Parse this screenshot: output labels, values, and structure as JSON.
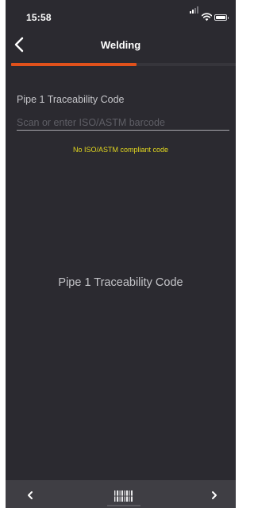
{
  "status_bar": {
    "time": "15:58"
  },
  "header": {
    "title": "Welding",
    "back_icon": "chevron-left-icon"
  },
  "progress": {
    "fraction": 0.56,
    "color": "#e0511b"
  },
  "form": {
    "field_label": "Pipe 1 Traceability Code",
    "input_value": "",
    "input_placeholder": "Scan or enter ISO/ASTM barcode",
    "warning": "No ISO/ASTM compliant code",
    "warning_color": "#e3d81f"
  },
  "center_label": "Pipe 1 Traceability Code",
  "bottom_bar": {
    "prev_icon": "chevron-left-icon",
    "scan_icon": "barcode-icon",
    "next_icon": "chevron-right-icon"
  },
  "colors": {
    "background": "#2b2a30",
    "bottom_bar": "#3f3e44",
    "accent": "#e0511b"
  }
}
